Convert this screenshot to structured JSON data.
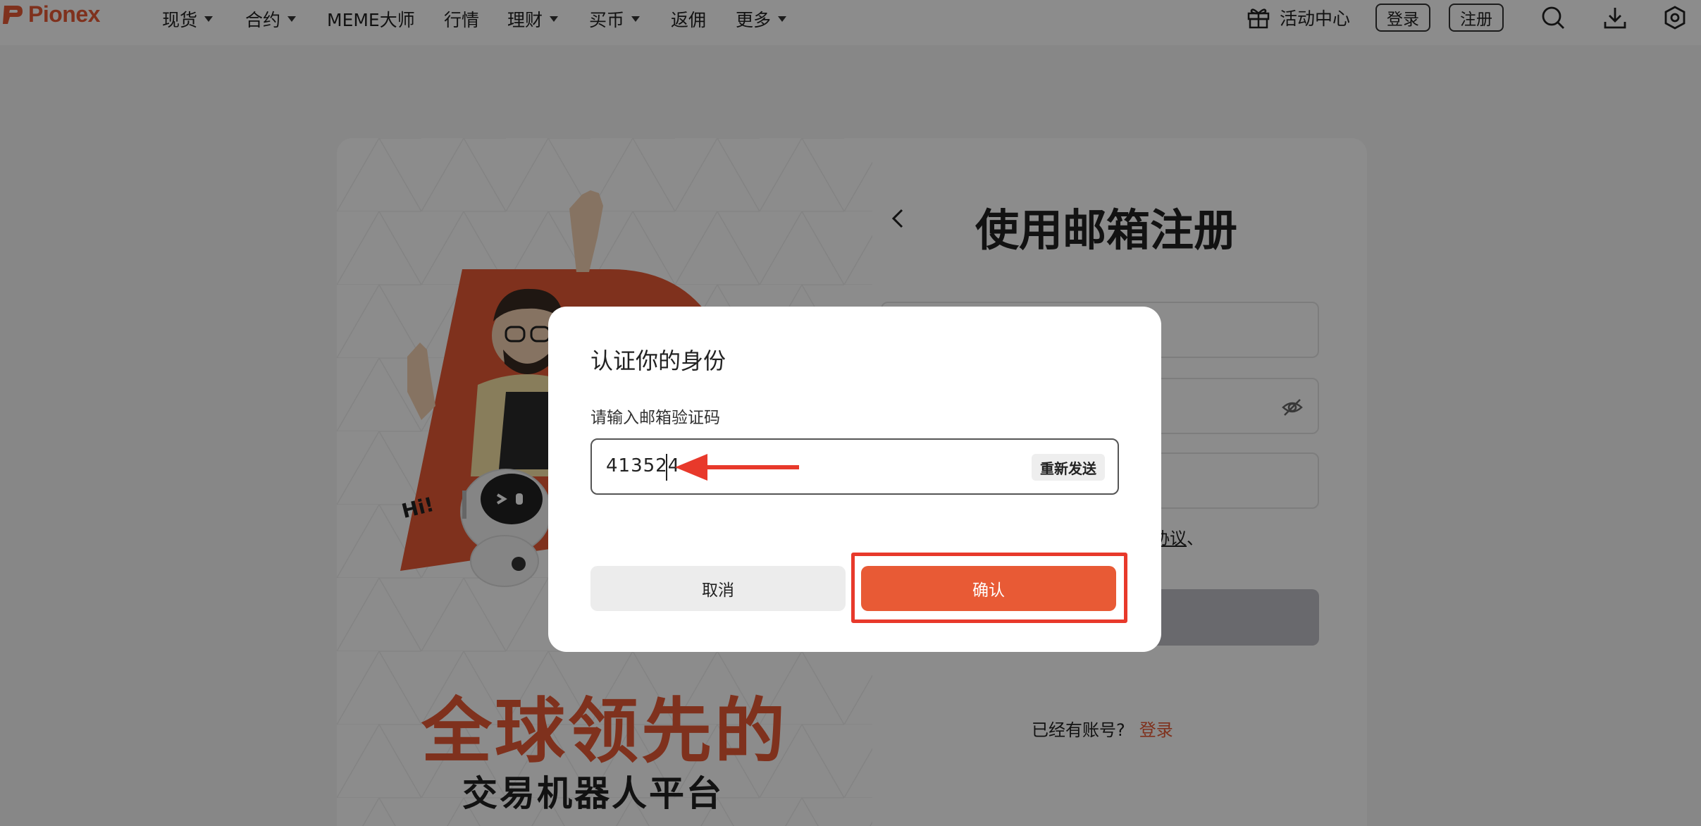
{
  "nav": {
    "brand": "Pionex",
    "items": [
      {
        "label": "现货",
        "dropdown": true
      },
      {
        "label": "合约",
        "dropdown": true
      },
      {
        "label": "MEME大师",
        "dropdown": false
      },
      {
        "label": "行情",
        "dropdown": false
      },
      {
        "label": "理财",
        "dropdown": true
      },
      {
        "label": "买币",
        "dropdown": true
      },
      {
        "label": "返佣",
        "dropdown": false
      },
      {
        "label": "更多",
        "dropdown": true
      }
    ],
    "activity_center": "活动中心",
    "login": "登录",
    "register": "注册"
  },
  "hero": {
    "title": "全球领先的",
    "subtitle": "交易机器人平台",
    "hi_text": "Hi!"
  },
  "register": {
    "title": "使用邮箱注册",
    "agree_text_part1": "协议",
    "agree_sep": "、",
    "agree_link2": "合约服务协议",
    "agree_tail": "、",
    "login_hint": "已经有账号?",
    "login_link": "登录"
  },
  "modal": {
    "title": "认证你的身份",
    "label": "请输入邮箱验证码",
    "code": "413524",
    "resend": "重新发送",
    "cancel": "取消",
    "confirm": "确认"
  },
  "colors": {
    "brand": "#e85a35",
    "highlight": "#e8392b"
  }
}
